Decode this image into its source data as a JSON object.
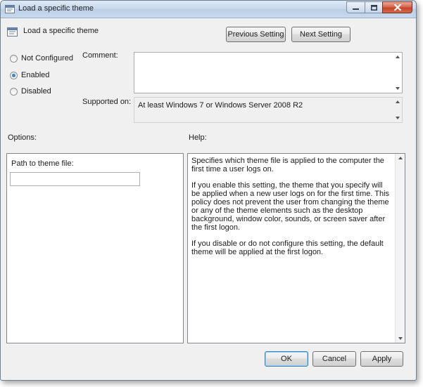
{
  "window": {
    "title": "Load a specific theme"
  },
  "header": {
    "title": "Load a specific theme",
    "previous_label": "Previous Setting",
    "next_label": "Next Setting"
  },
  "state": {
    "options": [
      {
        "label": "Not Configured",
        "selected": false
      },
      {
        "label": "Enabled",
        "selected": true
      },
      {
        "label": "Disabled",
        "selected": false
      }
    ]
  },
  "comment": {
    "label": "Comment:",
    "value": ""
  },
  "supported": {
    "label": "Supported on:",
    "value": "At least Windows 7 or Windows Server 2008 R2"
  },
  "options_panel": {
    "heading": "Options:",
    "path_label": "Path to theme file:",
    "path_value": ""
  },
  "help_panel": {
    "heading": "Help:",
    "paragraphs": [
      "Specifies which theme file is applied to the computer the first time a user logs on.",
      "If you enable this setting, the theme that you specify will be applied when a new user logs on for the first time.  This policy does not prevent the user from changing the theme or any of the theme elements such as the desktop background, window color, sounds, or screen saver after the first logon.",
      "If you disable or do not configure this setting, the default theme will be applied at the first logon."
    ]
  },
  "footer": {
    "ok_label": "OK",
    "cancel_label": "Cancel",
    "apply_label": "Apply"
  },
  "colors": {
    "accent": "#3c7fb1",
    "close_button": "#c7442a"
  }
}
